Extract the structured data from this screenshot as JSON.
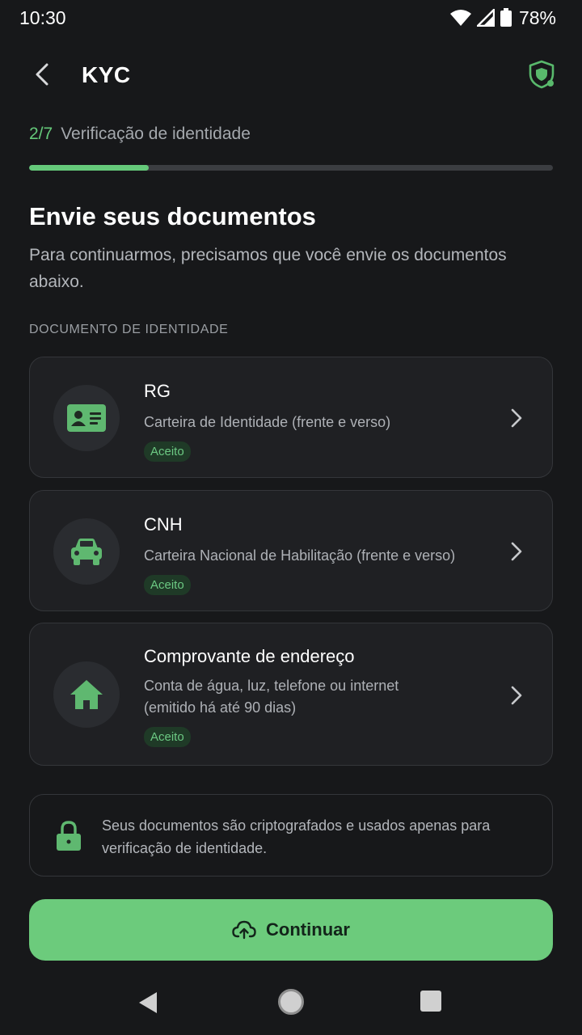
{
  "status_bar": {
    "time": "10:30",
    "battery": "78%"
  },
  "app_bar": {
    "title": "KYC",
    "back_icon": "chevron-left-icon",
    "shield_icon": "shield-check-icon"
  },
  "step": {
    "count": "2/7",
    "label": "Verificação de identidade",
    "progress_fraction": 0.2286
  },
  "heading": "Envie seus documentos",
  "subtitle": "Para continuarmos, precisamos que você envie os documentos abaixo.",
  "section_label": "DOCUMENTO DE IDENTIDADE",
  "documents": [
    {
      "title": "RG",
      "description": "Carteira de Identidade (frente e verso)",
      "badge": "Aceito",
      "icon": "id-card-icon"
    },
    {
      "title": "CNH",
      "description": "Carteira Nacional de Habilitação (frente e verso)",
      "badge": "Aceito",
      "icon": "car-icon"
    },
    {
      "title": "Comprovante de endereço",
      "description": "Conta de água, luz, telefone ou internet (emitido há até 90 dias)",
      "badge": "Aceito",
      "icon": "home-icon"
    }
  ],
  "security_note": "Seus documentos são criptografados e usados apenas para verificação de identidade.",
  "continue_button": {
    "label": "Continuar",
    "icon": "cloud-upload-icon"
  },
  "colors": {
    "background": "#17181a",
    "accent": "#6ccb7c",
    "card": "#1f2023",
    "badge_bg": "#1f3a27"
  }
}
